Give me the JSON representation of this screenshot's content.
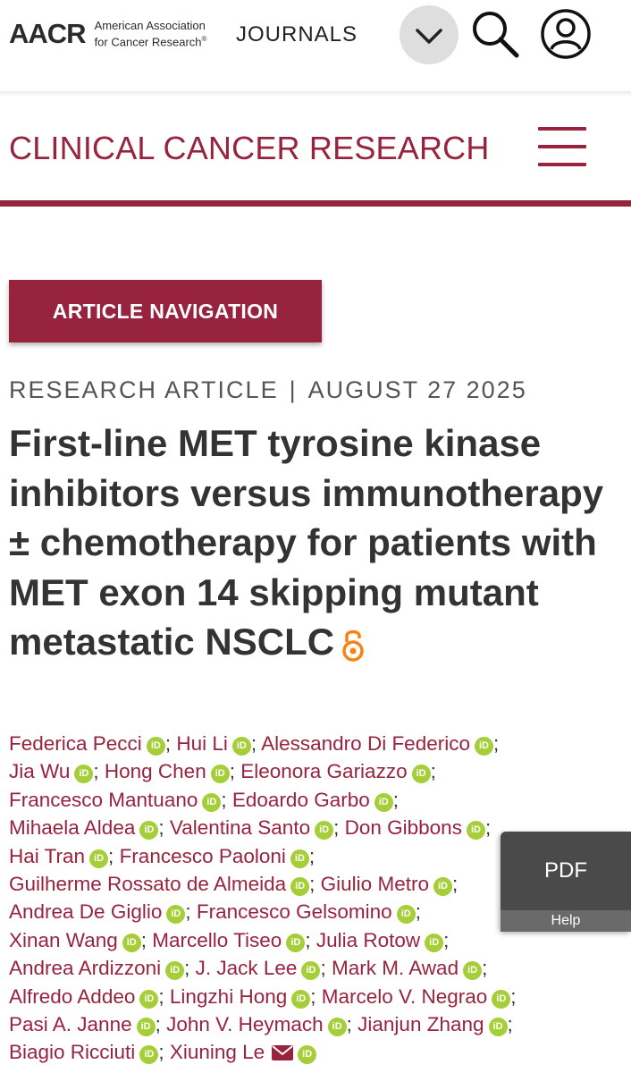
{
  "header": {
    "logo": "AACR",
    "org_name_line1": "American Association",
    "org_name_line2": "for Cancer Research",
    "org_reg": "®",
    "journals_label": "JOURNALS"
  },
  "journal": {
    "title": "CLINICAL CANCER RESEARCH",
    "accent_color": "#97233f"
  },
  "article_nav": {
    "label": "ARTICLE NAVIGATION"
  },
  "article": {
    "type": "RESEARCH ARTICLE",
    "separator": "|",
    "date": "AUGUST 27 2025",
    "title": "First-line MET tyrosine kinase inhibitors versus immunotherapy ± chemotherapy for patients with MET exon 14 skipping mutant metastatic NSCLC",
    "open_access_icon": "open-access-icon"
  },
  "authors": [
    [
      "Federica Pecci",
      "Hui Li",
      "Alessandro Di Federico"
    ],
    [
      "Jia Wu",
      "Hong Chen",
      "Eleonora Gariazzo"
    ],
    [
      "Francesco Mantuano",
      "Edoardo Garbo"
    ],
    [
      "Mihaela Aldea",
      "Valentina Santo",
      "Don Gibbons"
    ],
    [
      "Hai Tran",
      "Francesco Paoloni"
    ],
    [
      "Guilherme Rossato de Almeida",
      "Giulio Metro"
    ],
    [
      "Andrea De Giglio",
      "Francesco Gelsomino"
    ],
    [
      "Xinan Wang",
      "Marcello Tiseo",
      "Julia Rotow"
    ],
    [
      "Andrea Ardizzoni",
      "J. Jack Lee",
      "Mark M. Awad"
    ],
    [
      "Alfredo Addeo",
      "Lingzhi Hong",
      "Marcelo V. Negrao"
    ],
    [
      "Pasi A. Janne",
      "John V. Heymach",
      "Jianjun Zhang"
    ],
    [
      "Biagio Ricciuti",
      "Xiuning Le"
    ]
  ],
  "orcid_label": "iD",
  "corresponding_author": "Xiuning Le",
  "pdf_widget": {
    "label": "PDF",
    "help": "Help"
  }
}
